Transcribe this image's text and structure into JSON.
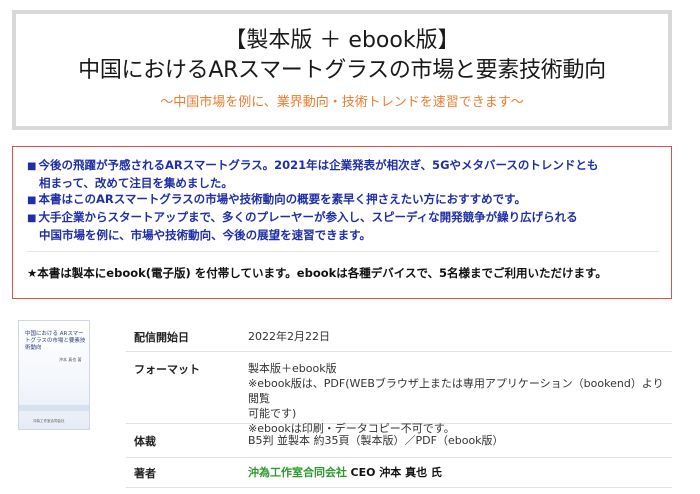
{
  "header": {
    "title_line1": "【製本版 ＋ ebook版】",
    "title_line2": "中国におけるARスマートグラスの市場と要素技術動向",
    "subtitle": "～中国市場を例に、業界動向・技術トレンドを速習できます～",
    "accent_color": "#ee7b2f"
  },
  "notice": {
    "bullets": [
      {
        "line1": "今後の飛躍が予感されるARスマートグラス。2021年は企業発表が相次ぎ、5Gやメタバースのトレンドとも",
        "line2": "相まって、改めて注目を集めました。"
      },
      {
        "line1": "本書はこのARスマートグラスの市場や技術動向の概要を素早く押さえたい方におすすめです。",
        "line2": ""
      },
      {
        "line1": "大手企業からスタートアップまで、多くのプレーヤーが参入し、スピーディな開発競争が繰り広げられる",
        "line2": "中国市場を例に、市場や技術動向、今後の展望を速習できます。"
      }
    ],
    "note": "★本書は製本にebook(電子版) を付帯しています。ebookは各種デバイスで、5名様までご利用いただけます。",
    "text_color": "#1f2fa8",
    "border_color": "#d9534f"
  },
  "cover": {
    "title": "中国における ARスマートグラスの市場と要素技術動向",
    "author": "沖本 真也 著",
    "publisher": "沖為工作室合同会社"
  },
  "spec": {
    "release_label": "配信開始日",
    "release_value": "2022年2月22日",
    "format_label": "フォーマット",
    "format_value1": "製本版＋ebook版",
    "format_value2": "※ebook版は、PDF(WEBブラウザ上または専用アプリケーション（bookend）より閲覧",
    "format_value3": "可能です)",
    "format_value4": "※ebookは印刷・データコピー不可です。",
    "binding_label": "体裁",
    "binding_value": "B5判 並製本 約35頁（製本版）／PDF（ebook版）",
    "author_label": "著者",
    "author_company": "沖為工作室合同会社",
    "author_rest": "CEO 沖本 真也 氏",
    "author_color": "#2c9b2c"
  }
}
